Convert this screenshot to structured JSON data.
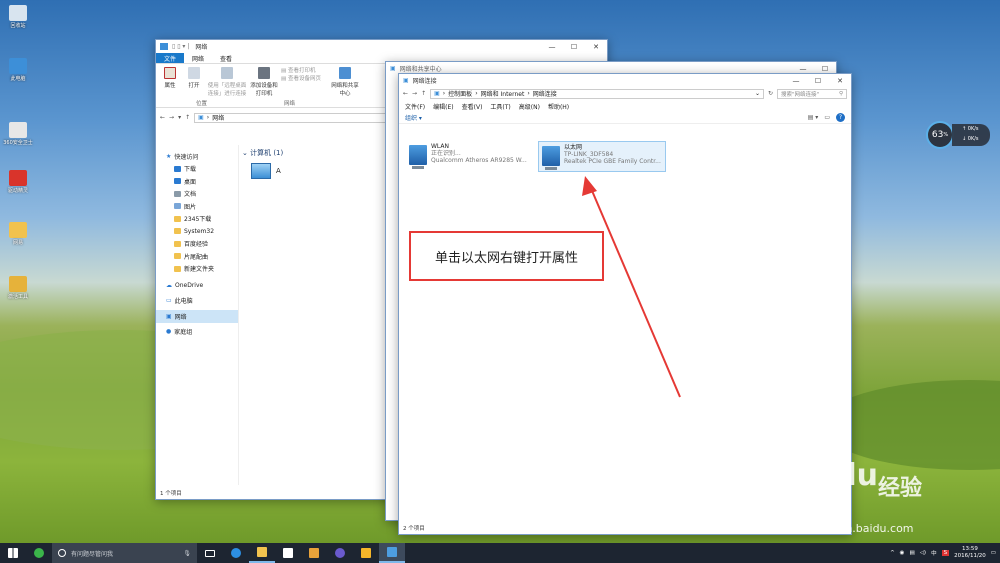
{
  "desktop": {
    "icons": [
      {
        "label": "回收站",
        "icon": "recycle-bin-icon",
        "color": "#d8e4ef"
      },
      {
        "label": "此电脑",
        "icon": "computer-icon",
        "color": "#3d8fd8"
      },
      {
        "label": "360安全卫士",
        "icon": "app-icon",
        "color": "#e7e7e7"
      },
      {
        "label": "驱动精灵",
        "icon": "app-icon",
        "color": "#d9342b"
      },
      {
        "label": "网易",
        "icon": "folder-icon",
        "color": "#f1c24e"
      },
      {
        "label": "激活工具",
        "icon": "tool-icon",
        "color": "#e6b23a"
      }
    ]
  },
  "explorer": {
    "title": "网络",
    "tabs": [
      "文件",
      "网络",
      "查看"
    ],
    "ribbon": {
      "properties": "属性",
      "open": "打开",
      "remote": "使用「远程桌面连接」进行连接",
      "add_device": "添加设备和打印机",
      "view_printers": "查看打印机",
      "view_devices": "查看设备网页",
      "center": "网络和共享中心",
      "group_location": "位置",
      "group_network": "网络"
    },
    "address": "网络",
    "nav": {
      "quick": "快速访问",
      "items": [
        "下载",
        "桌面",
        "文档",
        "图片",
        "2345下载",
        "System32",
        "百度经验",
        "片尾配曲",
        "新建文件夹"
      ],
      "onedrive": "OneDrive",
      "thispc": "此电脑",
      "network": "网络",
      "homegroup": "家庭组"
    },
    "section": "计算机 (1)",
    "computer": "A",
    "status": "1 个项目"
  },
  "sharing_window": {
    "title": "网络和共享中心"
  },
  "connections": {
    "title": "网络连接",
    "breadcrumb": [
      "控制面板",
      "网络和 Internet",
      "网络连接"
    ],
    "search_placeholder": "搜索\"网络连接\"",
    "menu": [
      "文件(F)",
      "编辑(E)",
      "查看(V)",
      "工具(T)",
      "高级(N)",
      "帮助(H)"
    ],
    "organize": "组织 ▾",
    "adapters": [
      {
        "name": "WLAN",
        "status": "正在识别...",
        "device": "Qualcomm Atheros AR9285 W..."
      },
      {
        "name": "以太网",
        "status": "TP-LINK_3DF584",
        "device": "Realtek PCIe GBE Family Contr..."
      }
    ],
    "status": "2 个项目"
  },
  "annotation": {
    "text": "单击以太网右键打开属性",
    "color": "#e53935"
  },
  "gauge": {
    "percent": "63",
    "unit": "%",
    "up": "0K/s",
    "down": "0K/s"
  },
  "taskbar": {
    "search_placeholder": "有问题尽管问我",
    "time": "13:59",
    "date": "2016/11/20",
    "ime": "中"
  },
  "watermark": {
    "brand": "Bai",
    "brand2": "du",
    "cn": "经验",
    "url": "jingyan.baidu.com"
  }
}
